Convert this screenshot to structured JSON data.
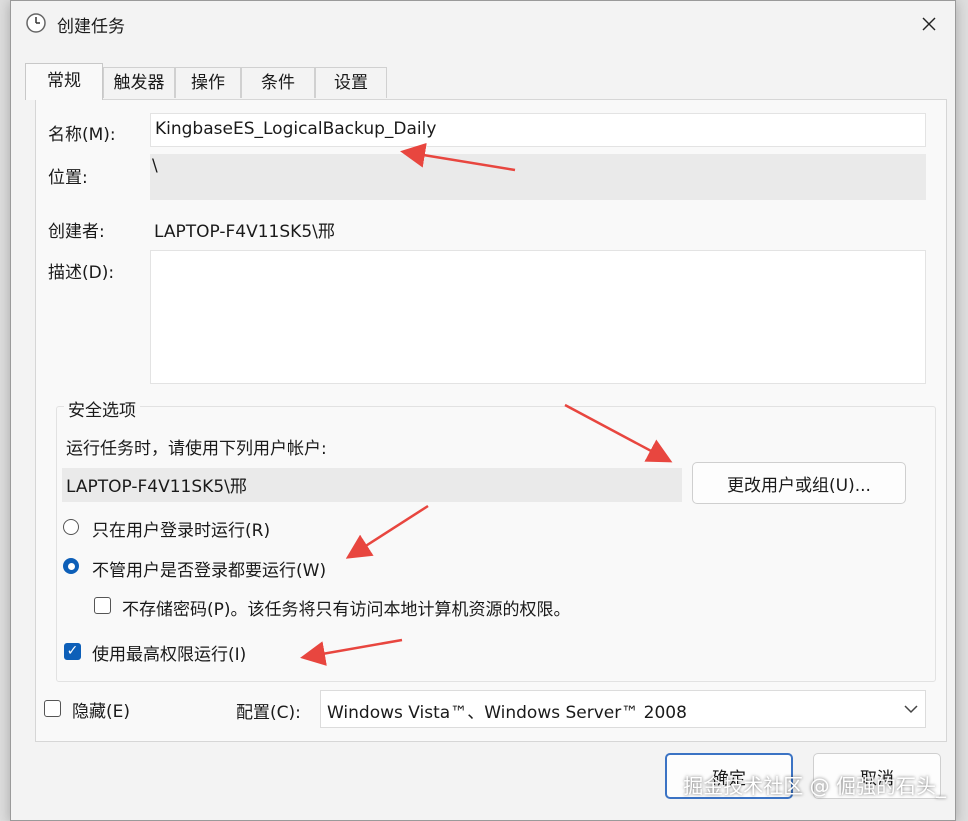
{
  "window": {
    "title": "创建任务"
  },
  "tabs": [
    "常规",
    "触发器",
    "操作",
    "条件",
    "设置"
  ],
  "general": {
    "name_label": "名称(M):",
    "name_value": "KingbaseES_LogicalBackup_Daily",
    "location_label": "位置:",
    "location_value": "\\",
    "author_label": "创建者:",
    "author_value": "LAPTOP-F4V11SK5\\邢",
    "description_label": "描述(D):",
    "description_value": ""
  },
  "security": {
    "group_title": "安全选项",
    "run_as_label": "运行任务时，请使用下列用户帐户:",
    "run_as_value": "LAPTOP-F4V11SK5\\邢",
    "change_user_button": "更改用户或组(U)...",
    "radio_logged_on": "只在用户登录时运行(R)",
    "radio_whether_logged": "不管用户是否登录都要运行(W)",
    "radio_selected": "whether_logged",
    "no_store_password": "不存储密码(P)。该任务将只有访问本地计算机资源的权限。",
    "no_store_password_checked": false,
    "highest_privileges": "使用最高权限运行(I)",
    "highest_privileges_checked": true
  },
  "footer": {
    "hidden_label": "隐藏(E)",
    "hidden_checked": false,
    "configure_label": "配置(C):",
    "configure_value": "Windows Vista™、Windows Server™ 2008",
    "ok_button": "确定",
    "cancel_button": "取消"
  },
  "watermark": "掘金技术社区 @ 倔强的石头_",
  "colors": {
    "accent": "#0d5fb8",
    "annotation_arrow": "#e8463f"
  },
  "icons": {
    "title": "clock-icon",
    "close": "close-icon",
    "dropdown": "chevron-down-icon",
    "check": "checkmark-icon"
  }
}
